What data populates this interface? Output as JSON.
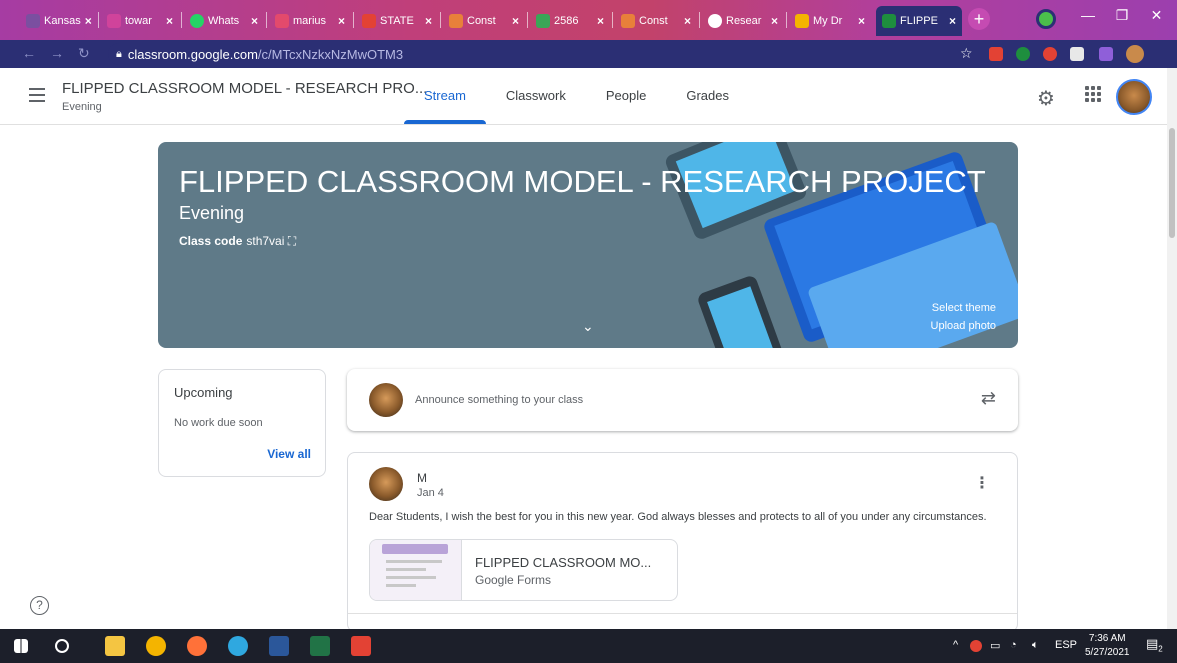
{
  "browser": {
    "tabs": [
      {
        "label": "Kansas",
        "color": "#7b4fa0"
      },
      {
        "label": "towar",
        "color": "#d0439b"
      },
      {
        "label": "Whats",
        "color": "#25d366"
      },
      {
        "label": "marius",
        "color": "#e34a6c"
      },
      {
        "label": "STATE",
        "color": "#e34234"
      },
      {
        "label": "Const",
        "color": "#e8803a"
      },
      {
        "label": "2586",
        "color": "#3aa657"
      },
      {
        "label": "Const",
        "color": "#e8803a"
      },
      {
        "label": "Resear",
        "color": "#ffffff"
      },
      {
        "label": "My Dr",
        "color": "#f4b400"
      },
      {
        "label": "FLIPPE",
        "color": "#1e8e3e"
      }
    ],
    "url_host": "classroom.google.com",
    "url_path": "/c/MTcxNzkxNzMwOTM3",
    "new_tab_label": "+",
    "win_min": "—",
    "win_max": "❐",
    "win_close": "✕"
  },
  "header": {
    "class_title": "FLIPPED CLASSROOM MODEL - RESEARCH PRO...",
    "class_section": "Evening",
    "tabs": [
      "Stream",
      "Classwork",
      "People",
      "Grades"
    ],
    "active_tab": "Stream"
  },
  "banner": {
    "title": "FLIPPED CLASSROOM MODEL - RESEARCH PROJECT",
    "section": "Evening",
    "class_code_label": "Class code",
    "class_code": "sth7vai",
    "select_theme": "Select theme",
    "upload_photo": "Upload photo",
    "background_color": "#5f7a88"
  },
  "upcoming": {
    "heading": "Upcoming",
    "status": "No work due soon",
    "view_all": "View all"
  },
  "announce": {
    "placeholder": "Announce something to your class"
  },
  "post": {
    "author": "M",
    "date": "Jan 4",
    "body": "Dear Students, I wish the best for you in this new year. God always blesses and protects to all of you under any circumstances.",
    "attachment_title": "FLIPPED CLASSROOM MO...",
    "attachment_type": "Google Forms"
  },
  "taskbar": {
    "lang": "ESP",
    "time": "7:36 AM",
    "date": "5/27/2021",
    "notif_count": "2"
  },
  "colors": {
    "accent": "#1967d2"
  }
}
